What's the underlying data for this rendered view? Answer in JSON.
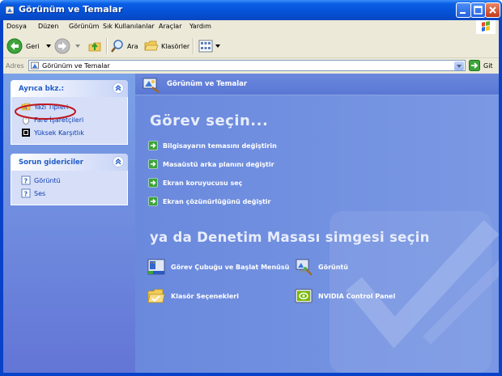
{
  "window": {
    "title": "Görünüm ve Temalar"
  },
  "menu": [
    "Dosya",
    "Düzen",
    "Görünüm",
    "Sık Kullanılanlar",
    "Araçlar",
    "Yardım"
  ],
  "toolbar": {
    "back_label": "Geri",
    "search_label": "Ara",
    "folders_label": "Klasörler"
  },
  "address": {
    "label": "Adres",
    "value": "Görünüm ve Temalar",
    "go_label": "Git"
  },
  "see_also": {
    "title": "Ayrıca bkz.:",
    "items": [
      {
        "label": "Yazı Tipleri",
        "icon": "fonts-folder-icon"
      },
      {
        "label": "Fare İşaretçileri",
        "icon": "mouse-pointer-icon"
      },
      {
        "label": "Yüksek Karşıtlık",
        "icon": "high-contrast-icon"
      }
    ]
  },
  "troubleshooters": {
    "title": "Sorun gidericiler",
    "items": [
      {
        "label": "Görüntü",
        "icon": "help-icon"
      },
      {
        "label": "Ses",
        "icon": "help-icon"
      }
    ]
  },
  "main": {
    "header_title": "Görünüm ve Temalar",
    "pick_task": "Görev seçin...",
    "tasks": [
      "Bilgisayarın temasını değiştirin",
      "Masaüstü arka planını değiştir",
      "Ekran koruyucusu seç",
      "Ekran çözünürlüğünü değiştir"
    ],
    "pick_icon": "ya da Denetim Masası simgesi seçin",
    "icons": [
      {
        "label": "Görev Çubuğu ve Başlat Menüsü",
        "icon": "taskbar-icon"
      },
      {
        "label": "Görüntü",
        "icon": "display-icon"
      },
      {
        "label": "Klasör Seçenekleri",
        "icon": "folder-options-icon"
      },
      {
        "label": "NVIDIA Control Panel",
        "icon": "nvidia-icon"
      }
    ]
  },
  "colors": {
    "accent": "#215dc6",
    "highlight_circle": "#c0161c",
    "main_bg": "#7a98e3"
  }
}
